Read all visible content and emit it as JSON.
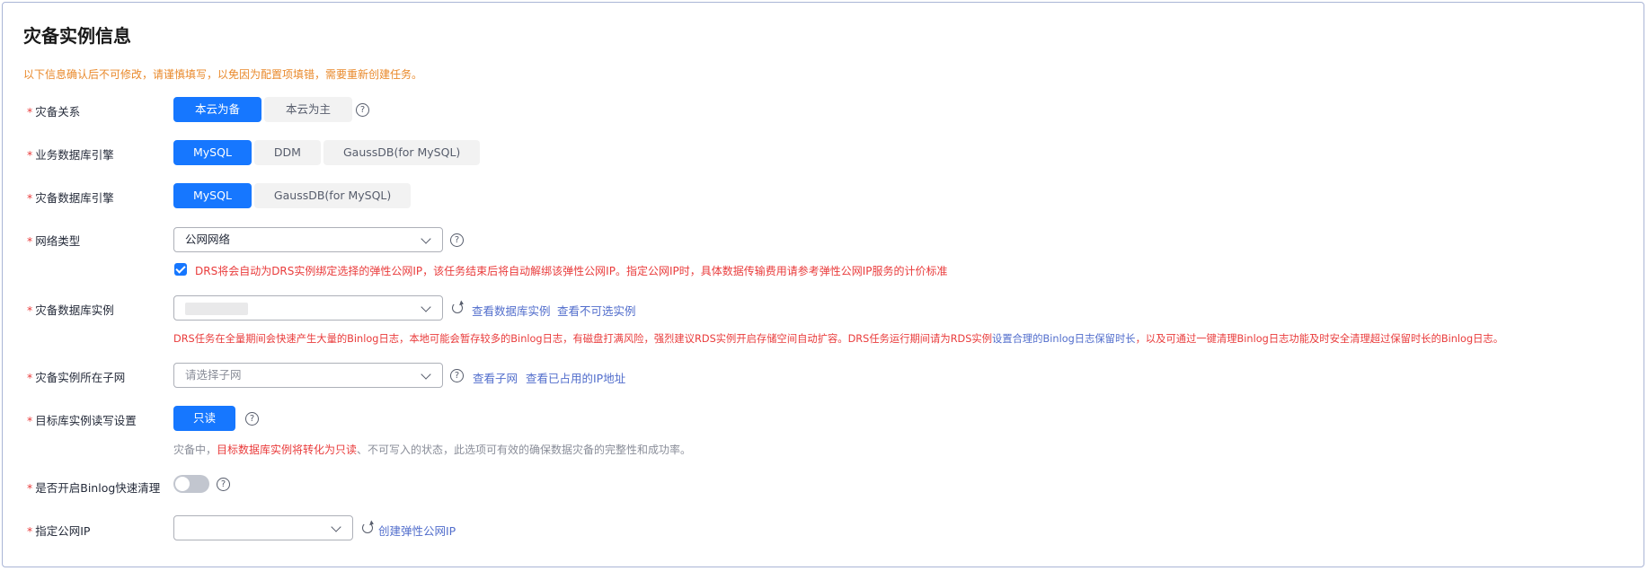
{
  "title": "灾备实例信息",
  "notice": "以下信息确认后不可修改，请谨慎填写，以免因为配置项填错，需要重新创建任务。",
  "rows": {
    "relation": {
      "label": "灾备关系",
      "options": [
        "本云为备",
        "本云为主"
      ],
      "selected": "本云为备"
    },
    "biz_engine": {
      "label": "业务数据库引擎",
      "options": [
        "MySQL",
        "DDM",
        "GaussDB(for MySQL)"
      ],
      "selected": "MySQL"
    },
    "dr_engine": {
      "label": "灾备数据库引擎",
      "options": [
        "MySQL",
        "GaussDB(for MySQL)"
      ],
      "selected": "MySQL"
    },
    "network": {
      "label": "网络类型",
      "value": "公网网络",
      "checkbox_text": "DRS将会自动为DRS实例绑定选择的弹性公网IP，该任务结束后将自动解绑该弹性公网IP。指定公网IP时，具体数据传输费用请参考弹性公网IP服务的计价标准"
    },
    "dr_instance": {
      "label": "灾备数据库实例",
      "links": [
        "查看数据库实例",
        "查看不可选实例"
      ],
      "warning_red_1": "DRS任务在全量期间会快速产生大量的Binlog日志，本地可能会暂存较多的Binlog日志，有磁盘打满风险，强烈建议RDS实例开启存储空间自动扩容。DRS任务运行期间请为RDS实例",
      "warning_blue": "设置合理的Binlog日志保留时长",
      "warning_red_2": "，以及可通过一键清理Binlog日志功能及时安全清理超过保留时长的Binlog日志。"
    },
    "subnet": {
      "label": "灾备实例所在子网",
      "placeholder": "请选择子网",
      "links": [
        "查看子网",
        "查看已占用的IP地址"
      ]
    },
    "rw": {
      "label": "目标库实例读写设置",
      "option": "只读",
      "hint_prefix": "灾备中，",
      "hint_red": "目标数据库实例将转化为只读",
      "hint_suffix": "、不可写入的状态，此选项可有效的确保数据灾备的完整性和成功率。"
    },
    "binlog": {
      "label": "是否开启Binlog快速清理",
      "enabled": false
    },
    "public_ip": {
      "label": "指定公网IP",
      "value": "",
      "link": "创建弹性公网IP"
    }
  },
  "colors": {
    "accent": "#1677ff",
    "required": "#e93b3b",
    "notice": "#e9892b",
    "link": "#526ecc"
  }
}
